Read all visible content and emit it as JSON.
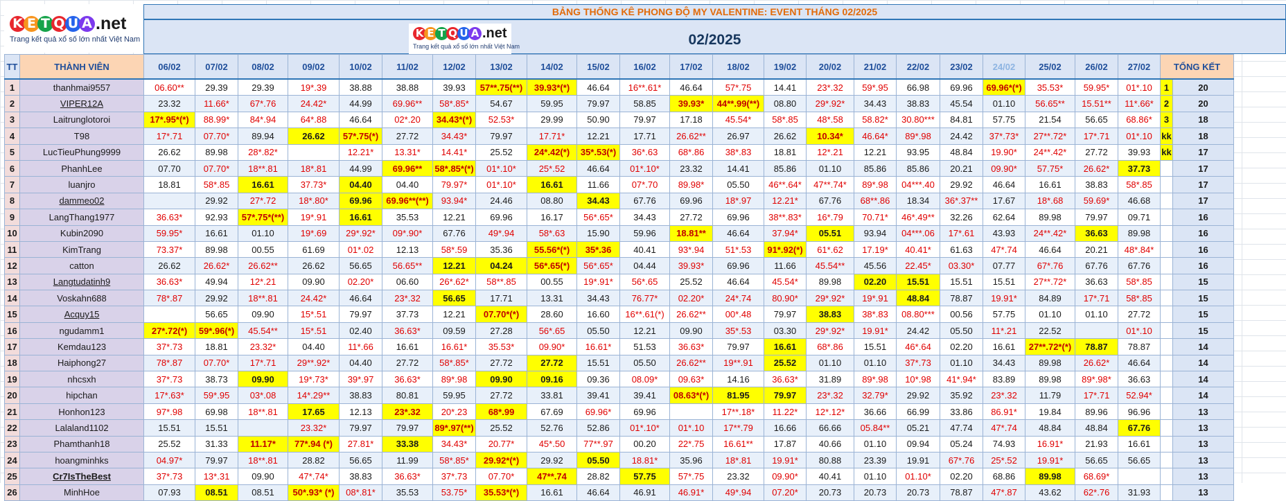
{
  "title": "BẢNG THỐNG KÊ PHONG ĐỘ MY VALENTINE: EVENT THÁNG 02/2025",
  "month": "02/2025",
  "logo": {
    "letters": [
      "K",
      "E",
      "T",
      "Q",
      "U",
      "A"
    ],
    "letter_colors": [
      "#e8262d",
      "#f7941d",
      "#16a34a",
      "#e8262d",
      "#2563eb",
      "#7c3aed"
    ],
    "suffix": ".net",
    "tagline": "Trang kết quả xổ số lớn nhất Việt Nam"
  },
  "headers": {
    "tt": "TT",
    "member": "THÀNH VIÊN",
    "total": "TỔNG KẾT",
    "dates": [
      "06/02",
      "07/02",
      "08/02",
      "09/02",
      "10/02",
      "11/02",
      "12/02",
      "13/02",
      "14/02",
      "15/02",
      "16/02",
      "17/02",
      "18/02",
      "19/02",
      "20/02",
      "21/02",
      "22/02",
      "23/02",
      "24/02",
      "25/02",
      "26/02",
      "27/02"
    ]
  },
  "rows": [
    {
      "tt": "1",
      "name": "thanhmai9557",
      "rank": "1",
      "total": "20",
      "cells": [
        "06.60**",
        "29.39",
        "29.39",
        "19*.39",
        "38.88",
        "38.88",
        "39.93",
        "57**.75(**)",
        "39.93*(*)",
        "46.64",
        "16**.61*",
        "46.64",
        "57*.75",
        "14.41",
        "23*.32",
        "59*.95",
        "66.98",
        "69.96",
        "69.96*(*)",
        "35.53*",
        "59.95*",
        "01*.10"
      ],
      "hl": [
        7,
        8,
        18
      ]
    },
    {
      "tt": "2",
      "name": "VIPER12A",
      "rank": "2",
      "total": "20",
      "cells": [
        "23.32",
        "11.66*",
        "67*.76",
        "24.42*",
        "44.99",
        "69.96**",
        "58*.85*",
        "54.67",
        "59.95",
        "79.97",
        "58.85",
        "39.93*",
        "44**.99(**)",
        "08.80",
        "29*.92*",
        "34.43",
        "38.83",
        "45.54",
        "01.10",
        "56.65**",
        "15.51**",
        "11*.66*"
      ],
      "hl": [
        11,
        12
      ]
    },
    {
      "tt": "3",
      "name": "Laitrunglotoroi",
      "rank": "3",
      "total": "18",
      "cells": [
        "17*.95*(*)",
        "88.99*",
        "84*.94",
        "64*.88",
        "46.64",
        "02*.20",
        "34.43*(*)",
        "52.53*",
        "29.99",
        "50.90",
        "79.97",
        "17.18",
        "45.54*",
        "58*.85",
        "48*.58",
        "58.82*",
        "30.80***",
        "84.81",
        "57.75",
        "21.54",
        "56.65",
        "68.86*"
      ],
      "hl": [
        0,
        6
      ]
    },
    {
      "tt": "4",
      "name": "T98",
      "rank": "kk",
      "total": "18",
      "cells": [
        "17*.71",
        "07.70*",
        "89.94",
        "26.62",
        "57*.75(*)",
        "27.72",
        "34.43*",
        "79.97",
        "17.71*",
        "12.21",
        "17.71",
        "26.62**",
        "26.97",
        "26.62",
        "10.34*",
        "46.64*",
        "89*.98",
        "24.42",
        "37*.73*",
        "27**.72*",
        "17*.71",
        "01*.10"
      ],
      "hl": [
        3,
        4,
        14
      ],
      "dark": [
        3
      ]
    },
    {
      "tt": "5",
      "name": "LucTieuPhung9999",
      "rank": "kk",
      "total": "17",
      "cells": [
        "26.62",
        "89.98",
        "28*.82*",
        "",
        "12.21*",
        "13.31*",
        "14.41*",
        "25.52",
        "24*.42(*)",
        "35*.53(*)",
        "36*.63",
        "68*.86",
        "38*.83",
        "18.81",
        "12*.21",
        "12.21",
        "93.95",
        "48.84",
        "19.90*",
        "24**.42*",
        "27.72",
        "39.93"
      ],
      "hl": [
        8,
        9
      ]
    },
    {
      "tt": "6",
      "name": "PhanhLee",
      "rank": "",
      "total": "17",
      "cells": [
        "07.70",
        "07.70*",
        "18**.81",
        "18*.81",
        "44.99",
        "69.96**",
        "58*.85*(*)",
        "01*.10*",
        "25*.52",
        "46.64",
        "01*.10*",
        "23.32",
        "14.41",
        "85.86",
        "01.10",
        "85.86",
        "85.86",
        "20.21",
        "09.90*",
        "57.75*",
        "26.62*",
        "37.73"
      ],
      "hl": [
        5,
        6,
        21
      ],
      "dark": [
        21
      ]
    },
    {
      "tt": "7",
      "name": "luanjro",
      "rank": "",
      "total": "17",
      "cells": [
        "18.81",
        "58*.85",
        "16.61",
        "37.73*",
        "04.40",
        "04.40",
        "79.97*",
        "01*.10*",
        "16.61",
        "11.66",
        "07*.70",
        "89.98*",
        "05.50",
        "46**.64*",
        "47**.74*",
        "89*.98",
        "04***.40",
        "29.92",
        "46.64",
        "16.61",
        "38.83",
        "58*.85"
      ],
      "hl": [
        2,
        4,
        8
      ],
      "dark": [
        2,
        4,
        8
      ]
    },
    {
      "tt": "8",
      "name": "dammeo02",
      "rank": "",
      "total": "17",
      "cells": [
        "",
        "29.92",
        "27*.72",
        "18*.80*",
        "69.96",
        "69.96**(**)",
        "93.94*",
        "24.46",
        "08.80",
        "34.43",
        "67.76",
        "69.96",
        "18*.97",
        "12.21*",
        "67.76",
        "68**.86",
        "18.34",
        "36*.37**",
        "17.67",
        "18*.68",
        "59.69*",
        "46.68"
      ],
      "hl": [
        4,
        5,
        9
      ],
      "dark": [
        4,
        9
      ]
    },
    {
      "tt": "9",
      "name": "LangThang1977",
      "rank": "",
      "total": "16",
      "cells": [
        "36.63*",
        "92.93",
        "57*.75*(**)",
        "19*.91",
        "16.61",
        "35.53",
        "12.21",
        "69.96",
        "16.17",
        "56*.65*",
        "34.43",
        "27.72",
        "69.96",
        "38**.83*",
        "16*.79",
        "70.71*",
        "46*.49**",
        "32.26",
        "62.64",
        "89.98",
        "79.97",
        "09.71"
      ],
      "hl": [
        2,
        4
      ],
      "dark": [
        4
      ]
    },
    {
      "tt": "10",
      "name": "Kubin2090",
      "rank": "",
      "total": "16",
      "cells": [
        "59.95*",
        "16.61",
        "01.10",
        "19*.69",
        "29*.92*",
        "09*.90*",
        "67.76",
        "49*.94",
        "58*.63",
        "15.90",
        "59.96",
        "18.81**",
        "46.64",
        "37.94*",
        "05.51",
        "93.94",
        "04***.06",
        "17*.61",
        "43.93",
        "24**.42*",
        "36.63",
        "89.98"
      ],
      "hl": [
        11,
        14,
        20
      ],
      "dark": [
        14,
        20
      ]
    },
    {
      "tt": "11",
      "name": "KimTrang",
      "rank": "",
      "total": "16",
      "cells": [
        "73.37*",
        "89.98",
        "00.55",
        "61.69",
        "01*.02",
        "12.13",
        "58*.59",
        "35.36",
        "55.56*(*)",
        "35*.36",
        "40.41",
        "93*.94",
        "51*.53",
        "91*.92(*)",
        "61*.62",
        "17.19*",
        "40.41*",
        "61.63",
        "47*.74",
        "46.64",
        "20.21",
        "48*.84*"
      ],
      "hl": [
        8,
        9,
        13
      ]
    },
    {
      "tt": "12",
      "name": "catton",
      "rank": "",
      "total": "16",
      "cells": [
        "26.62",
        "26.62*",
        "26.62**",
        "26.62",
        "56.65",
        "56.65**",
        "12.21",
        "04.24",
        "56*.65(*)",
        "56*.65*",
        "04.44",
        "39.93*",
        "69.96",
        "11.66",
        "45.54**",
        "45.56",
        "22.45*",
        "03.30*",
        "07.77",
        "67*.76",
        "67.76",
        "67.76"
      ],
      "hl": [
        6,
        7,
        8
      ],
      "dark": [
        6,
        7
      ]
    },
    {
      "tt": "13",
      "name": "Langtudatinh9",
      "rank": "",
      "total": "15",
      "cells": [
        "36.63*",
        "49.94",
        "12*.21",
        "09.90",
        "02.20*",
        "06.60",
        "26*.62*",
        "58**.85",
        "00.55",
        "19*.91*",
        "56*.65",
        "25.52",
        "46.64",
        "45.54*",
        "89.98",
        "02.20",
        "15.51",
        "15.51",
        "15.51",
        "27**.72*",
        "36.63",
        "58*.85"
      ],
      "hl": [
        15,
        16
      ],
      "dark": [
        15,
        16
      ]
    },
    {
      "tt": "14",
      "name": "Voskahn688",
      "rank": "",
      "total": "15",
      "cells": [
        "78*.87",
        "29.92",
        "18**.81",
        "24.42*",
        "46.64",
        "23*.32",
        "56.65",
        "17.71",
        "13.31",
        "34.43",
        "76.77*",
        "02.20*",
        "24*.74",
        "80.90*",
        "29*.92*",
        "19*.91",
        "48.84",
        "78.87",
        "19.91*",
        "84.89",
        "17*.71",
        "58*.85"
      ],
      "hl": [
        6,
        16
      ],
      "dark": [
        6,
        16
      ]
    },
    {
      "tt": "15",
      "name": "Acquy15",
      "rank": "",
      "total": "15",
      "cells": [
        "",
        "56.65",
        "09.90",
        "15*.51",
        "79.97",
        "37.73",
        "12.21",
        "07.70*(*)",
        "28.60",
        "16.60",
        "16**.61(*)",
        "26.62**",
        "00*.48",
        "79.97",
        "38.83",
        "38*.83",
        "08.80***",
        "00.56",
        "57.75",
        "01.10",
        "01.10",
        "27.72"
      ],
      "hl": [
        7,
        14
      ],
      "dark": [
        14
      ]
    },
    {
      "tt": "16",
      "name": "ngudamm1",
      "rank": "",
      "total": "15",
      "cells": [
        "27*.72(*)",
        "59*.96(*)",
        "45.54**",
        "15*.51",
        "02.40",
        "36.63*",
        "09.59",
        "27.28",
        "56*.65",
        "05.50",
        "12.21",
        "09.90",
        "35*.53",
        "03.30",
        "29*.92*",
        "19.91*",
        "24.42",
        "05.50",
        "11*.21",
        "22.52",
        "",
        "01*.10"
      ],
      "hl": [
        0,
        1
      ]
    },
    {
      "tt": "17",
      "name": "Kemdau123",
      "rank": "",
      "total": "14",
      "cells": [
        "37*.73",
        "18.81",
        "23.32*",
        "04.40",
        "11*.66",
        "16.61",
        "16.61*",
        "35.53*",
        "09.90*",
        "16.61*",
        "51.53",
        "36.63*",
        "79.97",
        "16.61",
        "68*.86",
        "15.51",
        "46*.64",
        "02.20",
        "16.61",
        "27**.72*(*)",
        "78.87",
        "78.87"
      ],
      "hl": [
        13,
        19,
        20
      ],
      "dark": [
        13,
        20
      ]
    },
    {
      "tt": "18",
      "name": "Haiphong27",
      "rank": "",
      "total": "14",
      "cells": [
        "78*.87",
        "07.70*",
        "17*.71",
        "29**.92*",
        "04.40",
        "27.72",
        "58*.85*",
        "27.72",
        "27.72",
        "15.51",
        "05.50",
        "26.62**",
        "19**.91",
        "25.52",
        "01.10",
        "01.10",
        "37*.73",
        "01.10",
        "34.43",
        "89.98",
        "26.62*",
        "46.64"
      ],
      "hl": [
        8,
        13
      ],
      "dark": [
        8,
        13
      ]
    },
    {
      "tt": "19",
      "name": "nhcsxh",
      "rank": "",
      "total": "14",
      "cells": [
        "37*.73",
        "38.73",
        "09.90",
        "19*.73*",
        "39*.97",
        "36.63*",
        "89*.98",
        "09.90",
        "09.16",
        "09.36",
        "08.09*",
        "09.63*",
        "14.16",
        "36.63*",
        "31.89",
        "89*.98",
        "10*.98",
        "41*.94*",
        "83.89",
        "89.98",
        "89*.98*",
        "36.63"
      ],
      "hl": [
        2,
        7,
        8
      ],
      "dark": [
        2,
        7,
        8
      ]
    },
    {
      "tt": "20",
      "name": "hipchan",
      "rank": "",
      "total": "14",
      "cells": [
        "17*.63*",
        "59*.95",
        "03*.08",
        "14*.29**",
        "38.83",
        "80.81",
        "59.95",
        "27.72",
        "33.81",
        "39.41",
        "39.41",
        "08.63*(*)",
        "81.95",
        "79.97",
        "23*.32",
        "32.79*",
        "29.92",
        "35.92",
        "23*.32",
        "11.79",
        "17*.71",
        "52.94*"
      ],
      "hl": [
        11,
        12,
        13
      ],
      "dark": [
        12,
        13
      ]
    },
    {
      "tt": "21",
      "name": "Honhon123",
      "rank": "",
      "total": "13",
      "cells": [
        "97*.98",
        "69.98",
        "18**.81",
        "17.65",
        "12.13",
        "23*.32",
        "20*.23",
        "68*.99",
        "67.69",
        "69.96*",
        "69.96",
        "",
        "17**.18*",
        "11.22*",
        "12*.12*",
        "36.66",
        "66.99",
        "33.86",
        "86.91*",
        "19.84",
        "89.96",
        "96.96"
      ],
      "hl": [
        3,
        5,
        7
      ],
      "dark": [
        3
      ]
    },
    {
      "tt": "22",
      "name": "Lalaland1102",
      "rank": "",
      "total": "13",
      "cells": [
        "15.51",
        "15.51",
        "",
        "23.32*",
        "79.97",
        "79.97",
        "89*.97(**)",
        "25.52",
        "52.76",
        "52.86",
        "01*.10*",
        "01*.10",
        "17**.79",
        "16.66",
        "66.66",
        "05.84**",
        "05.21",
        "47.74",
        "47*.74",
        "48.84",
        "48.84",
        "67.76"
      ],
      "hl": [
        6,
        21
      ],
      "dark": [
        21
      ]
    },
    {
      "tt": "23",
      "name": "Phamthanh18",
      "rank": "",
      "total": "13",
      "cells": [
        "25.52",
        "31.33",
        "11.17*",
        "77*.94 (*)",
        "27.81*",
        "33.38",
        "34.43*",
        "20.77*",
        "45*.50",
        "77**.97",
        "00.20",
        "22*.75",
        "16.61**",
        "17.87",
        "40.66",
        "01.10",
        "09.94",
        "05.24",
        "74.93",
        "16.91*",
        "21.93",
        "16.61"
      ],
      "hl": [
        2,
        3,
        5
      ],
      "dark": [
        5
      ]
    },
    {
      "tt": "24",
      "name": "hoangminhks",
      "rank": "",
      "total": "13",
      "cells": [
        "04.97*",
        "79.97",
        "18**.81",
        "28.82",
        "56.65",
        "11.99",
        "58*.85*",
        "29.92*(*)",
        "29.92",
        "05.50",
        "18.81*",
        "35.96",
        "18*.81",
        "19.91*",
        "80.88",
        "23.39",
        "19.91",
        "67*.76",
        "25*.52",
        "19.91*",
        "56.65",
        "56.65"
      ],
      "hl": [
        7,
        9
      ],
      "dark": [
        9
      ]
    },
    {
      "tt": "25",
      "name": "Cr7IsTheBest",
      "rank": "",
      "total": "13",
      "cells": [
        "37*.73",
        "13*.31",
        "09.90",
        "47*.74*",
        "38.83",
        "36.63*",
        "37*.73",
        "07.70*",
        "47**.74",
        "28.82",
        "57.75",
        "57*.75",
        "23.32",
        "09.90*",
        "40.41",
        "01.10",
        "01.10*",
        "02.20",
        "68.86",
        "89.98",
        "68.69*",
        ""
      ],
      "hl": [
        8,
        10,
        19
      ],
      "dark": [
        10,
        19
      ]
    },
    {
      "tt": "26",
      "name": "MinhHoe",
      "rank": "",
      "total": "13",
      "cells": [
        "07.93",
        "08.51",
        "08.51",
        "50*.93* (*)",
        "08*.81*",
        "35.53",
        "53.75*",
        "35.53*(*)",
        "16.61",
        "46.64",
        "46.91",
        "46.91*",
        "49*.94",
        "07.20*",
        "20.73",
        "20.73",
        "20.73",
        "78.87",
        "47*.87",
        "43.62",
        "62*.76",
        "31.93"
      ],
      "hl": [
        1,
        3,
        7
      ],
      "dark": [
        1
      ]
    }
  ]
}
